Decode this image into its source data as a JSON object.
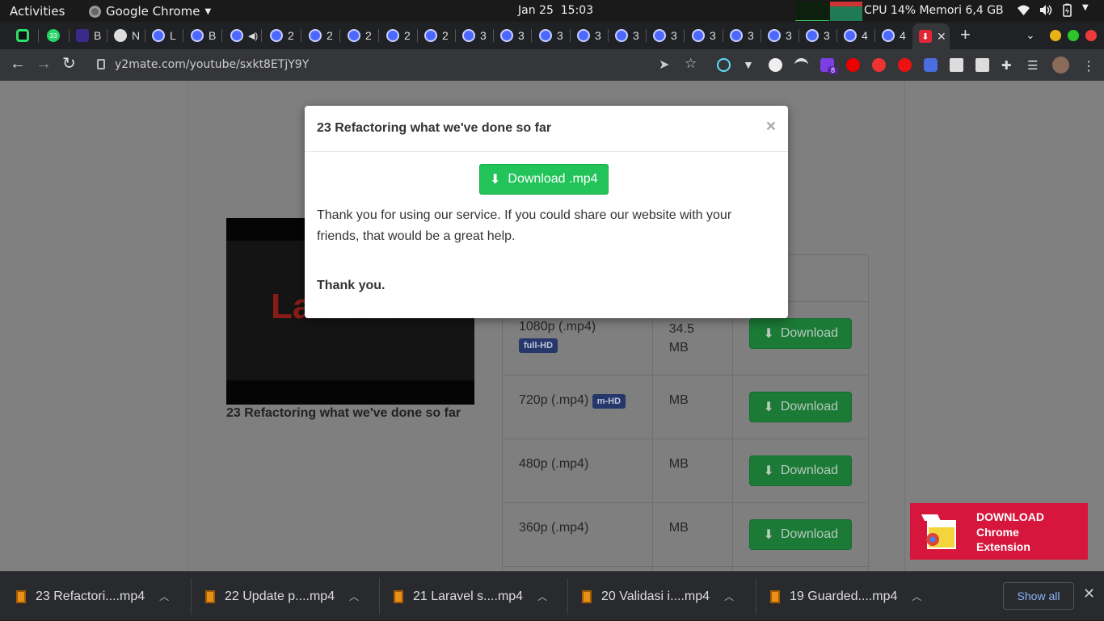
{
  "topbar": {
    "activities": "Activities",
    "app_name": "Google Chrome",
    "date": "Jan 25",
    "time": "15:03",
    "system_monitor": "CPU 14% Memori 6,4 GB"
  },
  "tabs": [
    {
      "label": ""
    },
    {
      "label": ""
    },
    {
      "label": "B"
    },
    {
      "label": "N"
    },
    {
      "label": "L"
    },
    {
      "label": "B"
    },
    {
      "label": ""
    },
    {
      "label": "2"
    },
    {
      "label": "2"
    },
    {
      "label": "2"
    },
    {
      "label": "2"
    },
    {
      "label": "2"
    },
    {
      "label": "3"
    },
    {
      "label": "3"
    },
    {
      "label": "3"
    },
    {
      "label": "3"
    },
    {
      "label": "3"
    },
    {
      "label": "3"
    },
    {
      "label": "3"
    },
    {
      "label": "3"
    },
    {
      "label": "3"
    },
    {
      "label": "3"
    },
    {
      "label": "4"
    },
    {
      "label": "4"
    }
  ],
  "whatsapp_badge": "33",
  "toolbar": {
    "url": "y2mate.com/youtube/sxkt8ETjY9Y",
    "ext_badge": "8"
  },
  "video": {
    "title": "23 Refactoring what we've done so far",
    "thumb_logo": "Laravel"
  },
  "table": {
    "header_partial": "d",
    "rows": [
      {
        "quality": "1080p (.mp4)",
        "badge": "full-HD",
        "size": "34.5 MB",
        "button": "Download"
      },
      {
        "quality": "720p (.mp4)",
        "badge": "m-HD",
        "size": "MB",
        "button": "Download"
      },
      {
        "quality": "480p (.mp4)",
        "badge": "",
        "size": "MB",
        "button": "Download"
      },
      {
        "quality": "360p (.mp4)",
        "badge": "",
        "size": "MB",
        "button": "Download"
      }
    ]
  },
  "modal": {
    "title": "23 Refactoring what we've done so far",
    "close": "×",
    "download_label": "Download .mp4",
    "message": "Thank you for using our service. If you could share our website with your friends, that would be a great help.",
    "thanks": "Thank you."
  },
  "promo": {
    "line1": "DOWNLOAD",
    "line2": "Chrome",
    "line3": "Extension"
  },
  "downloads": [
    {
      "name": "23 Refactori....mp4"
    },
    {
      "name": "22 Update p....mp4"
    },
    {
      "name": "21 Laravel s....mp4"
    },
    {
      "name": "20 Validasi i....mp4"
    },
    {
      "name": "19 Guarded....mp4"
    }
  ],
  "shelf": {
    "show_all": "Show all",
    "close": "✕"
  },
  "colors": {
    "modal_button": "#22c45a",
    "promo_bg": "#d6163c",
    "badge_bg": "#25376b"
  }
}
